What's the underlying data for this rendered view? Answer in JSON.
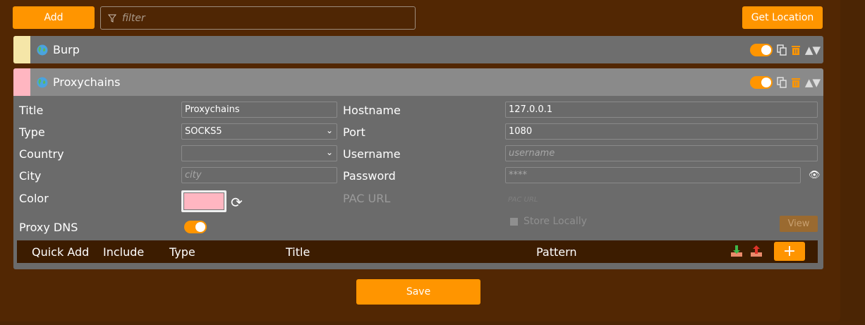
{
  "toolbar": {
    "add_label": "Add",
    "filter_placeholder": "filter",
    "get_location_label": "Get Location"
  },
  "proxies": [
    {
      "name": "Burp",
      "color": "#f5e6a8",
      "enabled": true
    },
    {
      "name": "Proxychains",
      "color": "#ffb6c1",
      "enabled": true
    }
  ],
  "detail": {
    "title_label": "Title",
    "title_value": "Proxychains",
    "type_label": "Type",
    "type_value": "SOCKS5",
    "country_label": "Country",
    "country_value": "",
    "city_label": "City",
    "city_placeholder": "city",
    "color_label": "Color",
    "color_value": "#ffb6c1",
    "proxy_dns_label": "Proxy DNS",
    "hostname_label": "Hostname",
    "hostname_value": "127.0.0.1",
    "port_label": "Port",
    "port_value": "1080",
    "username_label": "Username",
    "username_placeholder": "username",
    "password_label": "Password",
    "password_value": "****",
    "pac_url_label": "PAC URL",
    "pac_url_placeholder": "PAC URL",
    "store_locally_label": "Store Locally",
    "view_label": "View"
  },
  "patterns": {
    "columns": [
      "Quick Add",
      "Include",
      "Type",
      "Title",
      "Pattern"
    ],
    "add_label": "+"
  },
  "footer": {
    "save_label": "Save"
  },
  "colors": {
    "accent": "#ff9500",
    "background": "#522703",
    "panel": "#6b6b6b"
  }
}
